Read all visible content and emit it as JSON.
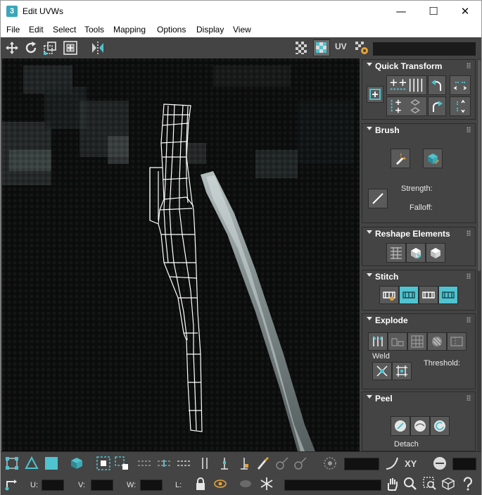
{
  "window": {
    "title": "Edit UVWs",
    "app_icon_text": "3",
    "minimize_glyph": "—",
    "maximize_glyph": "☐",
    "close_glyph": "✕"
  },
  "menu": [
    "File",
    "Edit",
    "Select",
    "Tools",
    "Mapping",
    "Options",
    "Display",
    "View"
  ],
  "toolbar": {
    "uv_label": "UV",
    "left_icons": [
      "move-icon",
      "rotate-icon",
      "scale-icon",
      "freeform-icon",
      "mirror-icon"
    ],
    "right_icons": [
      "checker-map-icon",
      "texture-map-icon",
      "options-gear-icon"
    ]
  },
  "rollouts": {
    "quick_transform": {
      "title": "Quick Transform"
    },
    "brush": {
      "title": "Brush",
      "strength_label": "Strength:",
      "falloff_label": "Falloff:"
    },
    "reshape_elements": {
      "title": "Reshape Elements"
    },
    "stitch": {
      "title": "Stitch"
    },
    "explode": {
      "title": "Explode",
      "weld_label": "Weld",
      "threshold_label": "Threshold:"
    },
    "peel": {
      "title": "Peel",
      "detach_label": "Detach"
    }
  },
  "bottom": {
    "u_label": "U:",
    "v_label": "V:",
    "w_label": "W:",
    "l_label": "L:",
    "xy_label": "XY"
  },
  "colors": {
    "accent": "#4fc3cf",
    "panel": "#444444",
    "field": "#111111",
    "viewport": "#0a0b0b",
    "wireframe": "#ffffff"
  }
}
